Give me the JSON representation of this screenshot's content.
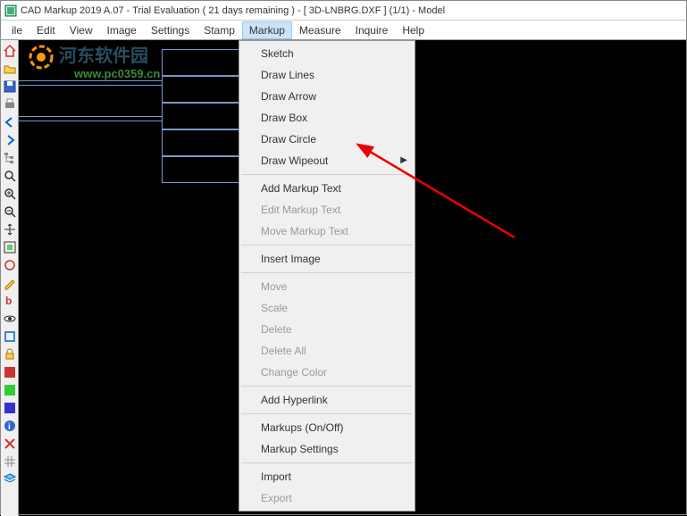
{
  "titlebar": {
    "text": "CAD Markup 2019 A.07 - Trial Evaluation ( 21 days remaining )  -  [ 3D-LNBRG.DXF ] (1/1)  -  Model"
  },
  "menubar": {
    "items": [
      "ile",
      "Edit",
      "View",
      "Image",
      "Settings",
      "Stamp",
      "Markup",
      "Measure",
      "Inquire",
      "Help"
    ],
    "active": 6
  },
  "watermark": {
    "main": "河东软件园",
    "sub": "www.pc0359.cn"
  },
  "dropdown": {
    "groups": [
      [
        {
          "label": "Sketch",
          "enabled": true
        },
        {
          "label": "Draw Lines",
          "enabled": true
        },
        {
          "label": "Draw Arrow",
          "enabled": true
        },
        {
          "label": "Draw Box",
          "enabled": true
        },
        {
          "label": "Draw Circle",
          "enabled": true
        },
        {
          "label": "Draw Wipeout",
          "enabled": true,
          "submenu": true
        }
      ],
      [
        {
          "label": "Add Markup Text",
          "enabled": true
        },
        {
          "label": "Edit Markup Text",
          "enabled": false
        },
        {
          "label": "Move Markup Text",
          "enabled": false
        }
      ],
      [
        {
          "label": "Insert Image",
          "enabled": true
        }
      ],
      [
        {
          "label": "Move",
          "enabled": false
        },
        {
          "label": "Scale",
          "enabled": false
        },
        {
          "label": "Delete",
          "enabled": false
        },
        {
          "label": "Delete All",
          "enabled": false
        },
        {
          "label": "Change Color",
          "enabled": false
        }
      ],
      [
        {
          "label": "Add Hyperlink",
          "enabled": true
        }
      ],
      [
        {
          "label": "Markups (On/Off)",
          "enabled": true
        },
        {
          "label": "Markup Settings",
          "enabled": true
        }
      ],
      [
        {
          "label": "Import",
          "enabled": true
        },
        {
          "label": "Export",
          "enabled": false
        }
      ]
    ]
  },
  "toolbar_icons": [
    "home",
    "open",
    "save",
    "print",
    "prev",
    "next",
    "tree",
    "zoom",
    "zoomin",
    "zoomout",
    "pan",
    "fit",
    "circle",
    "pencil",
    "text",
    "eye",
    "box",
    "lock",
    "color1",
    "color2",
    "color3",
    "info",
    "close",
    "grid",
    "layers"
  ]
}
